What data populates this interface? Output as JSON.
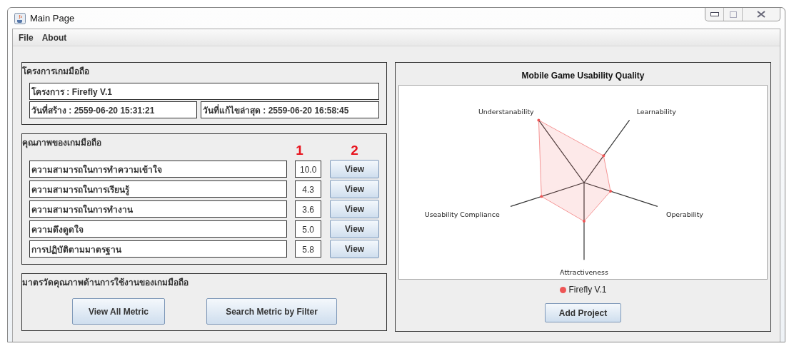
{
  "window": {
    "title": "Main Page"
  },
  "menu": [
    "File",
    "About"
  ],
  "project_panel": {
    "title": "โครงการเกมมือถือ",
    "project": "โครงการ : Firefly V.1",
    "created": "วันที่สร้าง : 2559-06-20 15:31:21",
    "modified": "วันที่แก้ไขล่าสุด : 2559-06-20 16:58:45"
  },
  "quality_panel": {
    "title": "คุณภาพของเกมมือถือ",
    "column_markers": [
      "1",
      "2"
    ],
    "rows": [
      {
        "name": "ความสามารถในการทำความเข้าใจ",
        "score": "10.0",
        "button": "View"
      },
      {
        "name": "ความสามารถในการเรียนรู้",
        "score": "4.3",
        "button": "View"
      },
      {
        "name": "ความสามารถในการทำงาน",
        "score": "3.6",
        "button": "View"
      },
      {
        "name": "ความดึงดูดใจ",
        "score": "5.0",
        "button": "View"
      },
      {
        "name": "การปฏิบัติตามมาตรฐาน",
        "score": "5.8",
        "button": "View"
      }
    ]
  },
  "metric_panel": {
    "title": "มาตรวัดคุณภาพด้านการใช้งานของเกมมือถือ",
    "buttons": [
      "View All Metric",
      "Search Metric by Filter"
    ]
  },
  "chart": {
    "title": "Mobile Game Usability Quality",
    "axis_labels": [
      "Understanability",
      "Learnability",
      "Operability",
      "Attractiveness",
      "Useability Compliance"
    ],
    "legend": [
      {
        "name": "Firefly V.1",
        "color": "#ee5555"
      }
    ]
  },
  "add_button": "Add Project"
}
